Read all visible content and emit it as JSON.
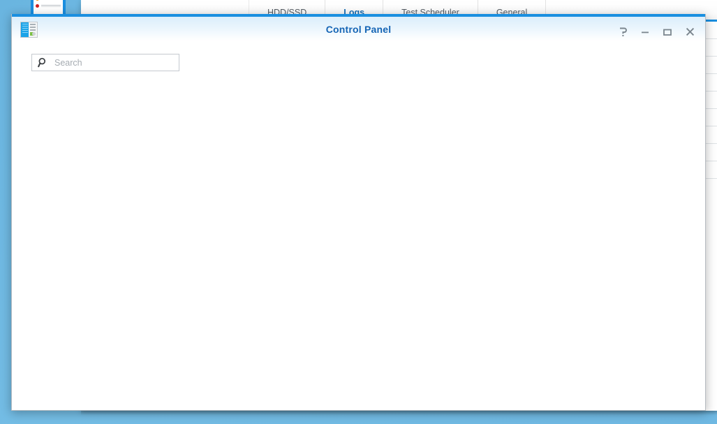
{
  "desktop": {
    "background_color": "#6fb8e2"
  },
  "background_window": {
    "name": "storage-manager-window",
    "tabs": [
      {
        "label": "HDD/SSD",
        "active": false
      },
      {
        "label": "Logs",
        "active": true
      },
      {
        "label": "Test Scheduler",
        "active": false
      },
      {
        "label": "General",
        "active": false
      }
    ],
    "accent_color": "#1a8fe0",
    "active_tab_color": "#1a6fb5",
    "inactive_tab_color": "#555c63",
    "row_count": 9
  },
  "background_widget": {
    "name": "log-entry-preview",
    "entries": [
      {
        "status_color": "#f5920b"
      },
      {
        "status_color": "#cf2020"
      }
    ]
  },
  "control_panel": {
    "title": "Control Panel",
    "title_color": "#1565b5",
    "accent_color": "#1a8fe0",
    "icon_name": "control-panel-icon",
    "search": {
      "value": "",
      "placeholder": "Search",
      "icon_name": "search-icon"
    },
    "window_controls": [
      {
        "name": "help-button",
        "glyph": "?",
        "label": "Help"
      },
      {
        "name": "minimize-button",
        "glyph": "–",
        "label": "Minimize"
      },
      {
        "name": "maximize-button",
        "glyph": "□",
        "label": "Maximize"
      },
      {
        "name": "close-button",
        "glyph": "✕",
        "label": "Close"
      }
    ],
    "content": {
      "state": "empty",
      "text": ""
    }
  }
}
